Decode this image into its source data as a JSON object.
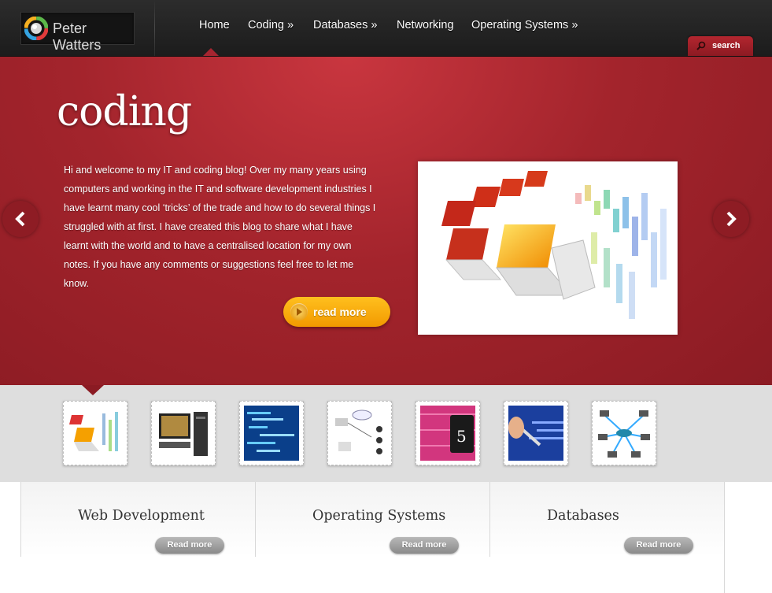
{
  "header": {
    "logo_text": "Peter Watters",
    "nav": [
      {
        "label": "Home"
      },
      {
        "label": "Coding »"
      },
      {
        "label": "Databases »"
      },
      {
        "label": "Networking"
      },
      {
        "label": "Operating Systems »"
      }
    ],
    "search_label": "search"
  },
  "hero": {
    "title": "coding",
    "body": "Hi and welcome to my IT and coding blog! Over my many years using computers and working in the IT and software development industries I have learnt many cool ‘tricks’ of the trade and how to do several things I struggled with at first. I have created this blog to share what I have learnt with the world and to have a centralised location for my own notes. If you have any comments or suggestions feel free to let me know.",
    "read_more_label": "read more"
  },
  "thumbnails": [
    {
      "name": "laptops-data-thumb"
    },
    {
      "name": "computer-tower-thumb"
    },
    {
      "name": "code-screen-thumb"
    },
    {
      "name": "network-diagram-thumb"
    },
    {
      "name": "html5-tablet-thumb",
      "text": "5"
    },
    {
      "name": "pen-code-thumb"
    },
    {
      "name": "network-hub-thumb"
    }
  ],
  "columns": [
    {
      "title": "Web Development",
      "button": "Read more"
    },
    {
      "title": "Operating Systems",
      "button": "Read more"
    },
    {
      "title": "Databases",
      "button": "Read more"
    }
  ],
  "colors": {
    "accent_red": "#a3242c",
    "button_orange": "#f7a40a",
    "header_dark": "#232323"
  }
}
